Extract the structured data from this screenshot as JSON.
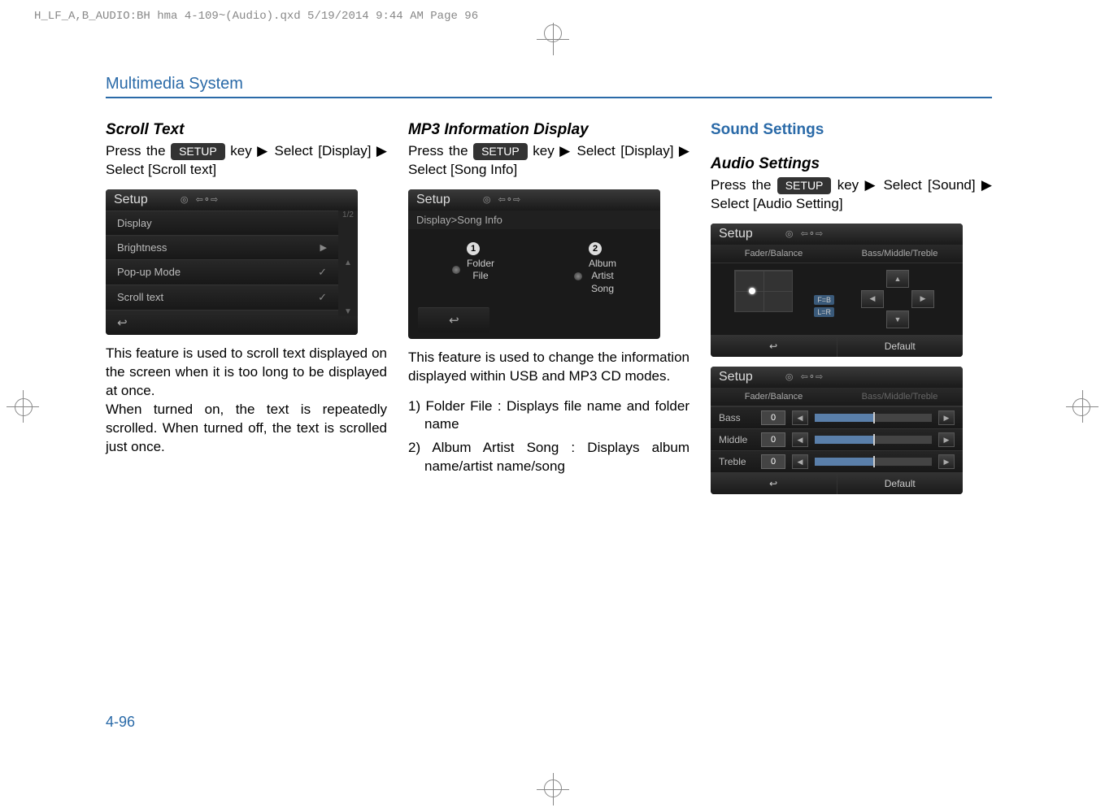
{
  "header_line": "H_LF_A,B_AUDIO:BH hma 4-109~(Audio).qxd  5/19/2014  9:44 AM  Page 96",
  "section_header": "Multimedia System",
  "page_number": "4-96",
  "setup_key": "SETUP",
  "col1": {
    "heading": "Scroll Text",
    "instr_1": "Press  the  ",
    "instr_2": "  key ▶ Select [Display] ▶ Select [Scroll text]",
    "screenshot": {
      "title": "Setup",
      "row_display": "Display",
      "page_indicator": "1/2",
      "row_brightness": "Brightness",
      "row_popup": "Pop-up Mode",
      "row_scroll": "Scroll text"
    },
    "para1": "This feature is used to scroll text displayed on the screen when it is too long to be displayed at once.",
    "para2": "When turned on, the text is repeatedly scrolled. When turned off, the text is scrolled just once."
  },
  "col2": {
    "heading": "MP3 Information Display",
    "instr_1": "Press  the  ",
    "instr_2": "  key ▶ Select [Display]  ▶ Select [Song Info]",
    "screenshot": {
      "title": "Setup",
      "breadcrumb": "Display>Song Info",
      "opt1_line1": "Folder",
      "opt1_line2": "File",
      "opt2_line1": "Album",
      "opt2_line2": "Artist",
      "opt2_line3": "Song"
    },
    "para1": "This feature is used to change the information displayed within USB and MP3 CD modes.",
    "list1": "1) Folder File : Displays file name and folder name",
    "list2": "2) Album Artist Song : Displays album name/artist name/song"
  },
  "col3": {
    "heading_blue": "Sound Settings",
    "heading": "Audio Settings",
    "instr_1": "Press  the  ",
    "instr_2": "  key ▶ Select [Sound]  ▶ Select [Audio Setting]",
    "screenshot1": {
      "title": "Setup",
      "tab1": "Fader/Balance",
      "tab2": "Bass/Middle/Treble",
      "tag_fb": "F=B",
      "tag_lr": "L=R",
      "default": "Default"
    },
    "screenshot2": {
      "title": "Setup",
      "tab1": "Fader/Balance",
      "tab2": "Bass/Middle/Treble",
      "bass": "Bass",
      "middle": "Middle",
      "treble": "Treble",
      "val": "0",
      "default": "Default"
    }
  }
}
